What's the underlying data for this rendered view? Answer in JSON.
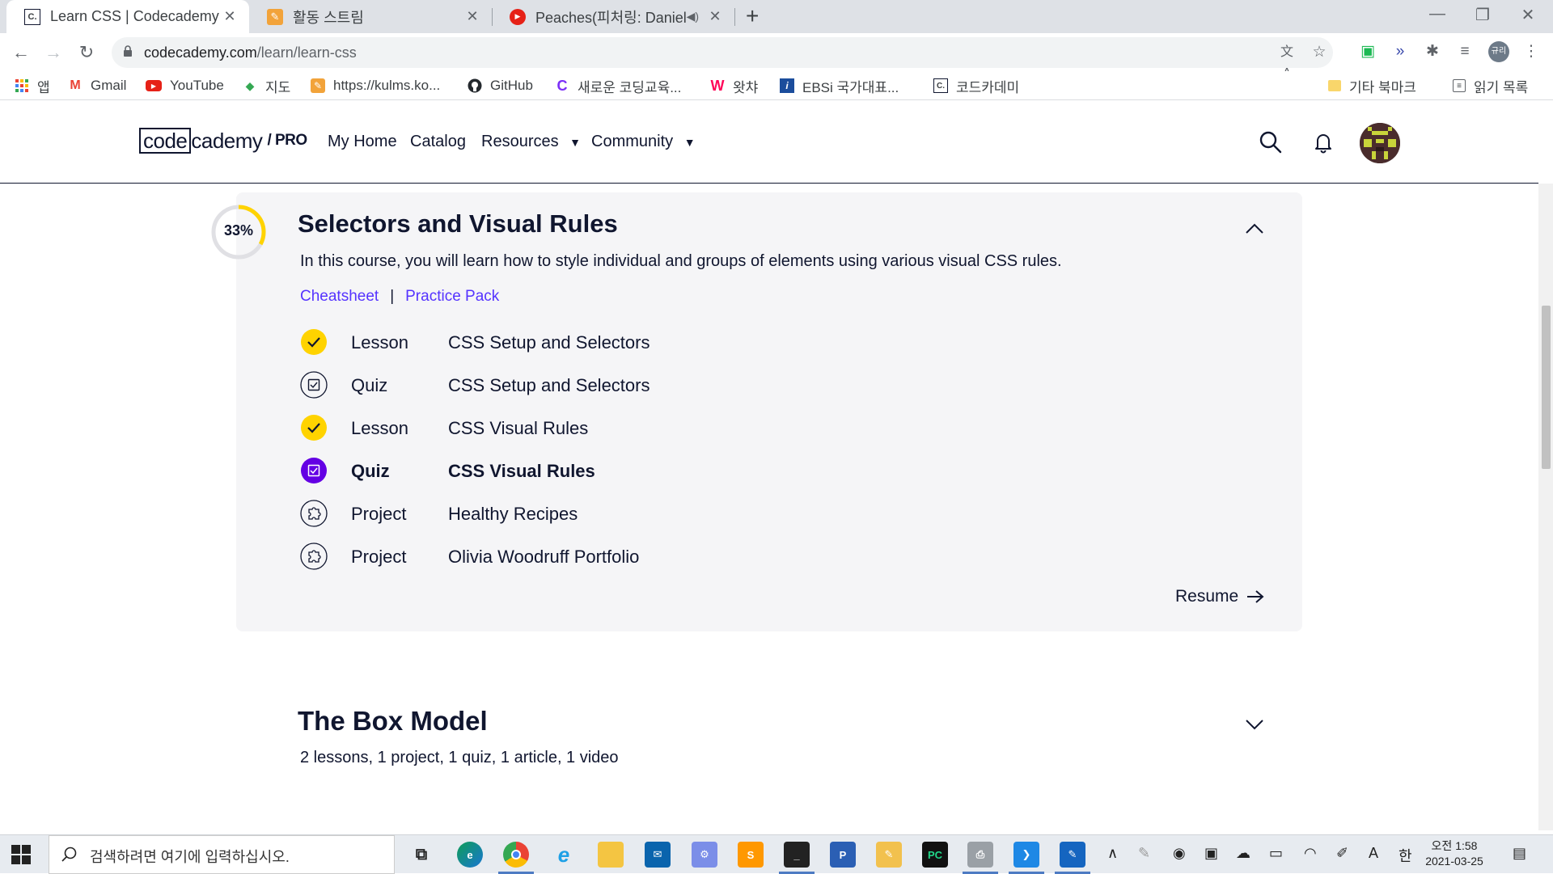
{
  "browser": {
    "tabs": [
      {
        "title": "Learn CSS | Codecademy",
        "favicon": "codecademy-icon",
        "active": true
      },
      {
        "title": "활동 스트림",
        "favicon": "pencil-icon",
        "active": false
      },
      {
        "title": "Peaches(피처링: Daniel",
        "favicon": "youtube-icon",
        "active": false
      }
    ],
    "url_host": "codecademy.com",
    "url_path": "/learn/learn-css",
    "bookmarks": [
      {
        "label": "앱",
        "icon": "apps-grid-icon"
      },
      {
        "label": "Gmail",
        "icon": "gmail-icon"
      },
      {
        "label": "YouTube",
        "icon": "youtube-icon"
      },
      {
        "label": "지도",
        "icon": "maps-icon"
      },
      {
        "label": "https://kulms.ko...",
        "icon": "pencil-icon"
      },
      {
        "label": "GitHub",
        "icon": "github-icon"
      },
      {
        "label": "새로운 코딩교육...",
        "icon": "c-logo-icon"
      },
      {
        "label": "왓챠",
        "icon": "watcha-icon"
      },
      {
        "label": "EBSi 국가대표...",
        "icon": "ebsi-icon"
      },
      {
        "label": "코드카데미",
        "icon": "codecademy-icon"
      }
    ],
    "other_bookmarks": "기타 북마크",
    "reading_list": "읽기 목록",
    "profile_badge": "규리"
  },
  "site": {
    "logo_boxed": "code",
    "logo_rest": "cademy",
    "logo_pro": "PRO",
    "nav": [
      {
        "label": "My Home"
      },
      {
        "label": "Catalog"
      },
      {
        "label": "Resources",
        "dropdown": true
      },
      {
        "label": "Community",
        "dropdown": true
      }
    ]
  },
  "module1": {
    "progress_label": "33%",
    "progress_fraction": 0.33,
    "title": "Selectors and Visual Rules",
    "description": "In this course, you will learn how to style individual and groups of elements using various visual CSS rules.",
    "links": [
      "Cheatsheet",
      "Practice Pack"
    ],
    "link_separator": "|",
    "items": [
      {
        "kind": "Lesson",
        "name": "CSS Setup and Selectors",
        "status": "complete",
        "icon": "check-icon"
      },
      {
        "kind": "Quiz",
        "name": "CSS Setup and Selectors",
        "status": "todo",
        "icon": "quiz-icon"
      },
      {
        "kind": "Lesson",
        "name": "CSS Visual Rules",
        "status": "complete",
        "icon": "check-icon"
      },
      {
        "kind": "Quiz",
        "name": "CSS Visual Rules",
        "status": "current",
        "icon": "quiz-icon"
      },
      {
        "kind": "Project",
        "name": "Healthy Recipes",
        "status": "todo",
        "icon": "puzzle-icon"
      },
      {
        "kind": "Project",
        "name": "Olivia Woodruff Portfolio",
        "status": "todo",
        "icon": "puzzle-icon"
      }
    ],
    "resume_label": "Resume"
  },
  "module2": {
    "title": "The Box Model",
    "description": "2 lessons, 1 project, 1 quiz, 1 article, 1 video"
  },
  "taskbar": {
    "search_placeholder": "검색하려면 여기에 입력하십시오.",
    "time": "오전 1:58",
    "date": "2021-03-25",
    "ime_lang": "A",
    "ime_mode": "한"
  },
  "colors": {
    "brand_navy": "#10162f",
    "link_purple": "#5533ff",
    "complete_yellow": "#ffd300",
    "current_purple": "#6400e4",
    "card_bg": "#f5f5f7"
  }
}
